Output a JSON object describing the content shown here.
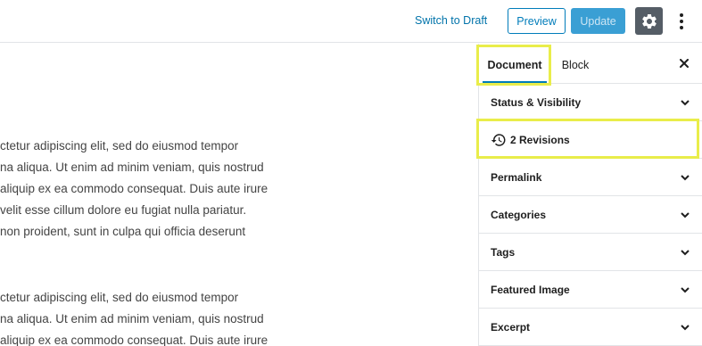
{
  "toolbar": {
    "switch_to_draft": "Switch to Draft",
    "preview": "Preview",
    "update": "Update",
    "settings_icon": "gear-icon",
    "more_icon": "more-vertical-icon"
  },
  "editor": {
    "paragraph1": [
      "ctetur adipiscing elit, sed do eiusmod tempor",
      "na aliqua. Ut enim ad minim veniam, quis nostrud",
      "aliquip ex ea commodo consequat. Duis aute irure",
      "velit esse cillum dolore eu fugiat nulla pariatur.",
      "non proident, sunt in culpa qui officia deserunt"
    ],
    "paragraph2": [
      "ctetur adipiscing elit, sed do eiusmod tempor",
      "na aliqua. Ut enim ad minim veniam, quis nostrud",
      "aliquip ex ea commodo consequat. Duis aute irure"
    ]
  },
  "sidebar": {
    "tabs": [
      {
        "label": "Document",
        "active": true
      },
      {
        "label": "Block",
        "active": false
      }
    ],
    "close_icon": "close-icon",
    "panels": {
      "status": "Status & Visibility",
      "revisions": "2 Revisions",
      "permalink": "Permalink",
      "categories": "Categories",
      "tags": "Tags",
      "featured_image": "Featured Image",
      "excerpt": "Excerpt"
    }
  },
  "colors": {
    "accent": "#007cba",
    "highlight": "#e9ed4a",
    "settings_bg": "#555d66"
  }
}
